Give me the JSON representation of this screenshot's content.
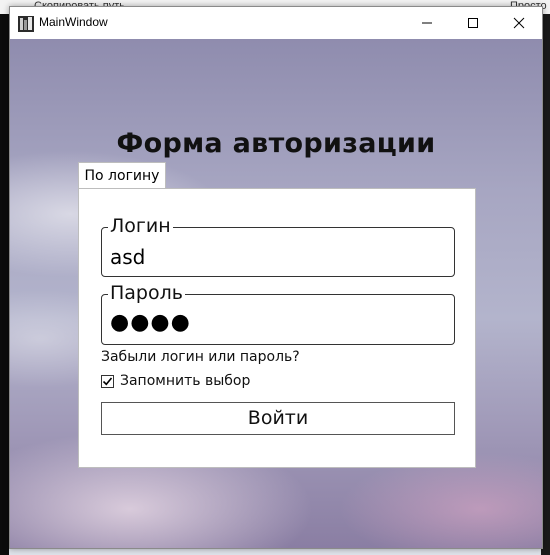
{
  "background": {
    "copy_path_label": "Скопировать путь",
    "simple_label": "Просто"
  },
  "window": {
    "title": "MainWindow"
  },
  "form": {
    "title": "Форма авторизации",
    "tab_label": "По логину",
    "login": {
      "label": "Логин",
      "value": "asd"
    },
    "password": {
      "label": "Пароль",
      "masked_value": "●●●●"
    },
    "forgot_link": "Забыли логин или пароль?",
    "remember": {
      "label": "Запомнить выбор",
      "checked": true
    },
    "submit_label": "Войти"
  },
  "colors": {
    "sky_top": "#8f8cae",
    "sky_bottom": "#8a7ea3",
    "panel": "#ffffff",
    "border": "#333333"
  }
}
